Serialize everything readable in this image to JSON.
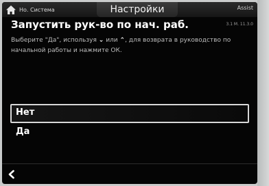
{
  "header": {
    "home_label": "Но. Система",
    "title": "Настройки",
    "assist_label": "Assist",
    "version": "3.1 М. 11.3.0"
  },
  "page": {
    "heading": "Запустить рук-во по нач. раб.",
    "desc_part1": "Выберите \"Да\", используя",
    "desc_or": "или",
    "desc_part2": ", для возврата в руководство по начальной работы и нажмите ОК.",
    "down_glyph": "⌄",
    "up_glyph": "⌃"
  },
  "options": [
    {
      "label": "Нет",
      "selected": true
    },
    {
      "label": "Да",
      "selected": false
    }
  ],
  "icons": {
    "home": "home-icon",
    "back": "chevron-left-icon"
  },
  "colors": {
    "screen_bg": "#050505",
    "text": "#ffffff",
    "selection_border": "#d8d8d8",
    "bezel": "#c9cbcb"
  }
}
